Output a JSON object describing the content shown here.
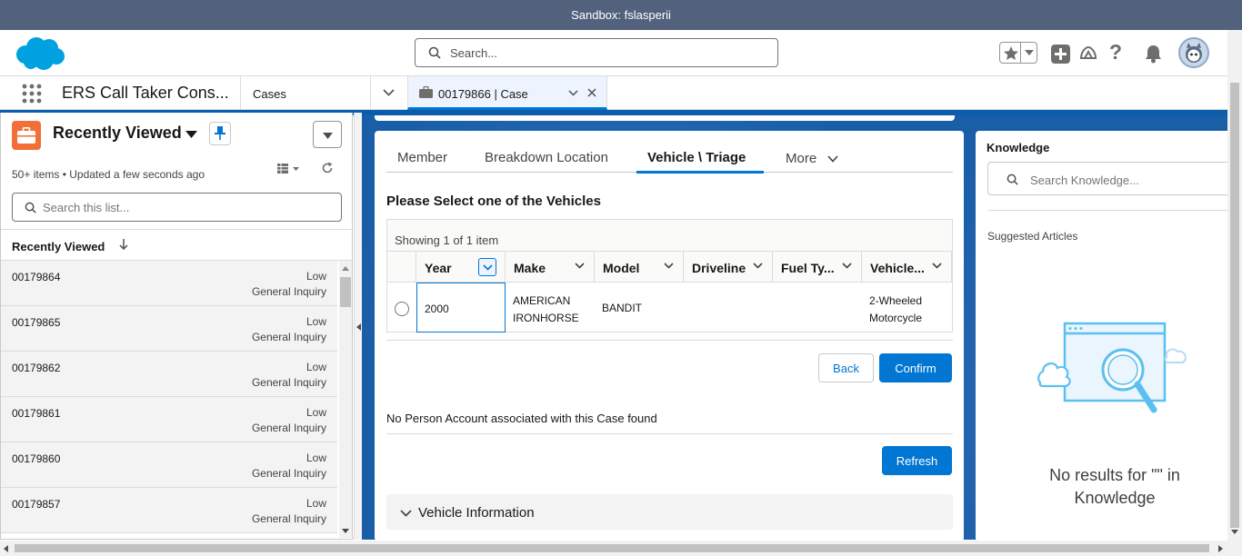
{
  "sandbox": {
    "label": "Sandbox: fslasperii"
  },
  "header": {
    "search_placeholder": "Search..."
  },
  "nav": {
    "app_name": "ERS Call Taker Cons...",
    "object_tab": "Cases",
    "record_tab": "00179866 | Case"
  },
  "sidebar": {
    "title": "Recently Viewed",
    "meta": "50+ items • Updated a few seconds ago",
    "search_placeholder": "Search this list...",
    "column_header": "Recently Viewed",
    "items": [
      {
        "number": "00179864",
        "priority": "Low",
        "type": "General Inquiry"
      },
      {
        "number": "00179865",
        "priority": "Low",
        "type": "General Inquiry"
      },
      {
        "number": "00179862",
        "priority": "Low",
        "type": "General Inquiry"
      },
      {
        "number": "00179861",
        "priority": "Low",
        "type": "General Inquiry"
      },
      {
        "number": "00179860",
        "priority": "Low",
        "type": "General Inquiry"
      },
      {
        "number": "00179857",
        "priority": "Low",
        "type": "General Inquiry"
      }
    ]
  },
  "main": {
    "tabs": [
      "Member",
      "Breakdown Location",
      "Vehicle \\ Triage",
      "More"
    ],
    "active_tab": "Vehicle \\ Triage",
    "section_title": "Please Select one of the Vehicles",
    "table": {
      "showing": "Showing 1 of 1 item",
      "columns": [
        "Year",
        "Make",
        "Model",
        "Driveline",
        "Fuel Ty...",
        "Vehicle..."
      ],
      "rows": [
        {
          "year": "2000",
          "make_line1": "AMERICAN",
          "make_line2": "IRONHORSE",
          "model": "BANDIT",
          "driveline": "",
          "fuel": "",
          "vehicle_line1": "2-Wheeled",
          "vehicle_line2": "Motorcycle"
        }
      ]
    },
    "back_label": "Back",
    "confirm_label": "Confirm",
    "no_account_message": "No Person Account associated with this Case found",
    "refresh_label": "Refresh",
    "vehicle_info_label": "Vehicle Information"
  },
  "knowledge": {
    "title": "Knowledge",
    "search_placeholder": "Search Knowledge...",
    "suggested_label": "Suggested Articles",
    "empty_line1": "No results for \"\" in",
    "empty_line2": "Knowledge"
  },
  "colors": {
    "brand": "#0176d3",
    "sandbox_bar": "#52627d",
    "main_bg": "#1b5ea8",
    "cases_icon": "#f26f38",
    "salesforce_logo": "#00a1e0"
  }
}
